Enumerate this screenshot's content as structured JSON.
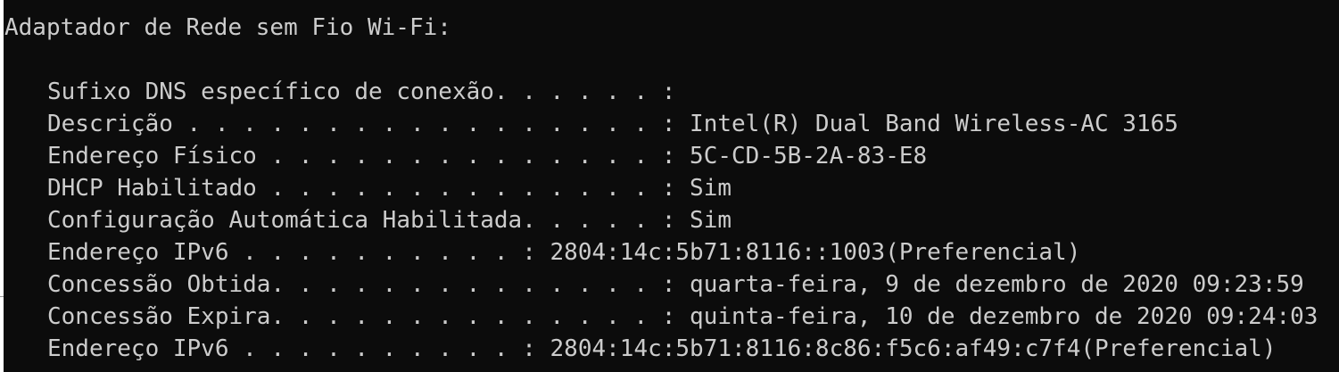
{
  "terminal": {
    "header": "Adaptador de Rede sem Fio Wi-Fi:",
    "lines": [
      "Sufixo DNS específico de conexão. . . . . . :",
      "Descrição . . . . . . . . . . . . . . . . . : Intel(R) Dual Band Wireless-AC 3165",
      "Endereço Físico . . . . . . . . . . . . . . : 5C-CD-5B-2A-83-E8",
      "DHCP Habilitado . . . . . . . . . . . . . . : Sim",
      "Configuração Automática Habilitada. . . . . : Sim",
      "Endereço IPv6 . . . . . . . . . . : 2804:14c:5b71:8116::1003(Preferencial)",
      "Concessão Obtida. . . . . . . . . . . . . . : quarta-feira, 9 de dezembro de 2020 09:23:59",
      "Concessão Expira. . . . . . . . . . . . . . : quinta-feira, 10 de dezembro de 2020 09:24:03",
      "Endereço IPv6 . . . . . . . . . . : 2804:14c:5b71:8116:8c86:f5c6:af49:c7f4(Preferencial)"
    ]
  }
}
